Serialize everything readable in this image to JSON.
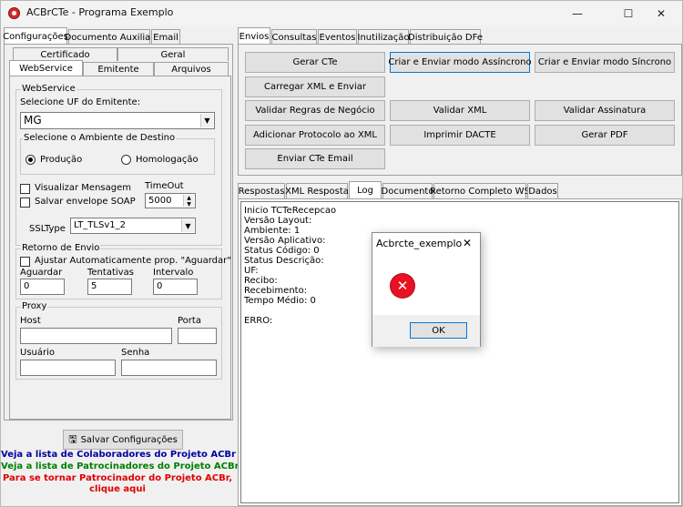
{
  "window": {
    "title": "ACBrCTe - Programa Exemplo",
    "minimize_glyph": "—",
    "maximize_glyph": "☐",
    "close_glyph": "✕"
  },
  "left_tabs": [
    "Configurações",
    "Documento Auxiliar",
    "Email"
  ],
  "config_tabs_row1": [
    "Certificado",
    "Geral"
  ],
  "config_tabs_row2": [
    "WebService",
    "Emitente",
    "Arquivos"
  ],
  "webservice": {
    "legend": "WebService",
    "uf_label": "Selecione UF do Emitente:",
    "uf_value": "MG",
    "ambiente_legend": "Selecione o Ambiente de Destino",
    "producao": "Produção",
    "homologacao": "Homologação",
    "visualizar": "Visualizar Mensagem",
    "salvar_envelope": "Salvar envelope SOAP",
    "timeout_label": "TimeOut",
    "timeout_value": "5000",
    "ssltype_label": "SSLType",
    "ssltype_value": "LT_TLSv1_2"
  },
  "retorno": {
    "legend": "Retorno de Envio",
    "ajustar": "Ajustar Automaticamente prop. \"Aguardar\"",
    "aguardar_label": "Aguardar",
    "aguardar_value": "0",
    "tentativas_label": "Tentativas",
    "tentativas_value": "5",
    "intervalo_label": "Intervalo",
    "intervalo_value": "0"
  },
  "proxy": {
    "legend": "Proxy",
    "host_label": "Host",
    "porta_label": "Porta",
    "usuario_label": "Usuário",
    "senha_label": "Senha"
  },
  "salvar_config": "Salvar Configurações",
  "links": {
    "colaboradores": "Veja a lista de Colaboradores do Projeto ACBr",
    "patrocinadores": "Veja a lista de Patrocinadores do Projeto ACBr",
    "tornar": "Para se tornar Patrocinador do Projeto ACBr,",
    "clique": "clique aqui"
  },
  "right_tabs": [
    "Envios",
    "Consultas",
    "Eventos",
    "Inutilização",
    "Distribuição DFe"
  ],
  "envios_buttons": {
    "gerar_cte": "Gerar CTe",
    "criar_async": "Criar e Enviar modo Assíncrono",
    "criar_sync": "Criar e Enviar modo Síncrono",
    "carregar_xml": "Carregar XML e Enviar",
    "validar_regras": "Validar Regras de Negócio",
    "validar_xml": "Validar XML",
    "validar_assinatura": "Validar Assinatura",
    "adicionar_protocolo": "Adicionar Protocolo ao XML",
    "imprimir_dacte": "Imprimir DACTE",
    "gerar_pdf": "Gerar PDF",
    "enviar_email": "Enviar CTe Email"
  },
  "result_tabs": [
    "Respostas",
    "XML Resposta",
    "Log",
    "Documento",
    "Retorno Completo WS",
    "Dados"
  ],
  "log_lines": [
    "Inicio TCTeRecepcao",
    "Versão Layout:",
    "Ambiente: 1",
    "Versão Aplicativo:",
    "Status Código: 0",
    "Status Descrição:",
    "UF:",
    "Recibo:",
    "Recebimento:",
    "Tempo Médio: 0",
    "",
    "ERRO:"
  ],
  "dialog": {
    "title": "Acbrcte_exemplo",
    "ok": "OK",
    "close_glyph": "✕",
    "error_glyph": "✕"
  },
  "colors": {
    "link_blue": "#0000a0",
    "link_green": "#008000",
    "link_red": "#e00000",
    "error_red": "#e81123"
  }
}
